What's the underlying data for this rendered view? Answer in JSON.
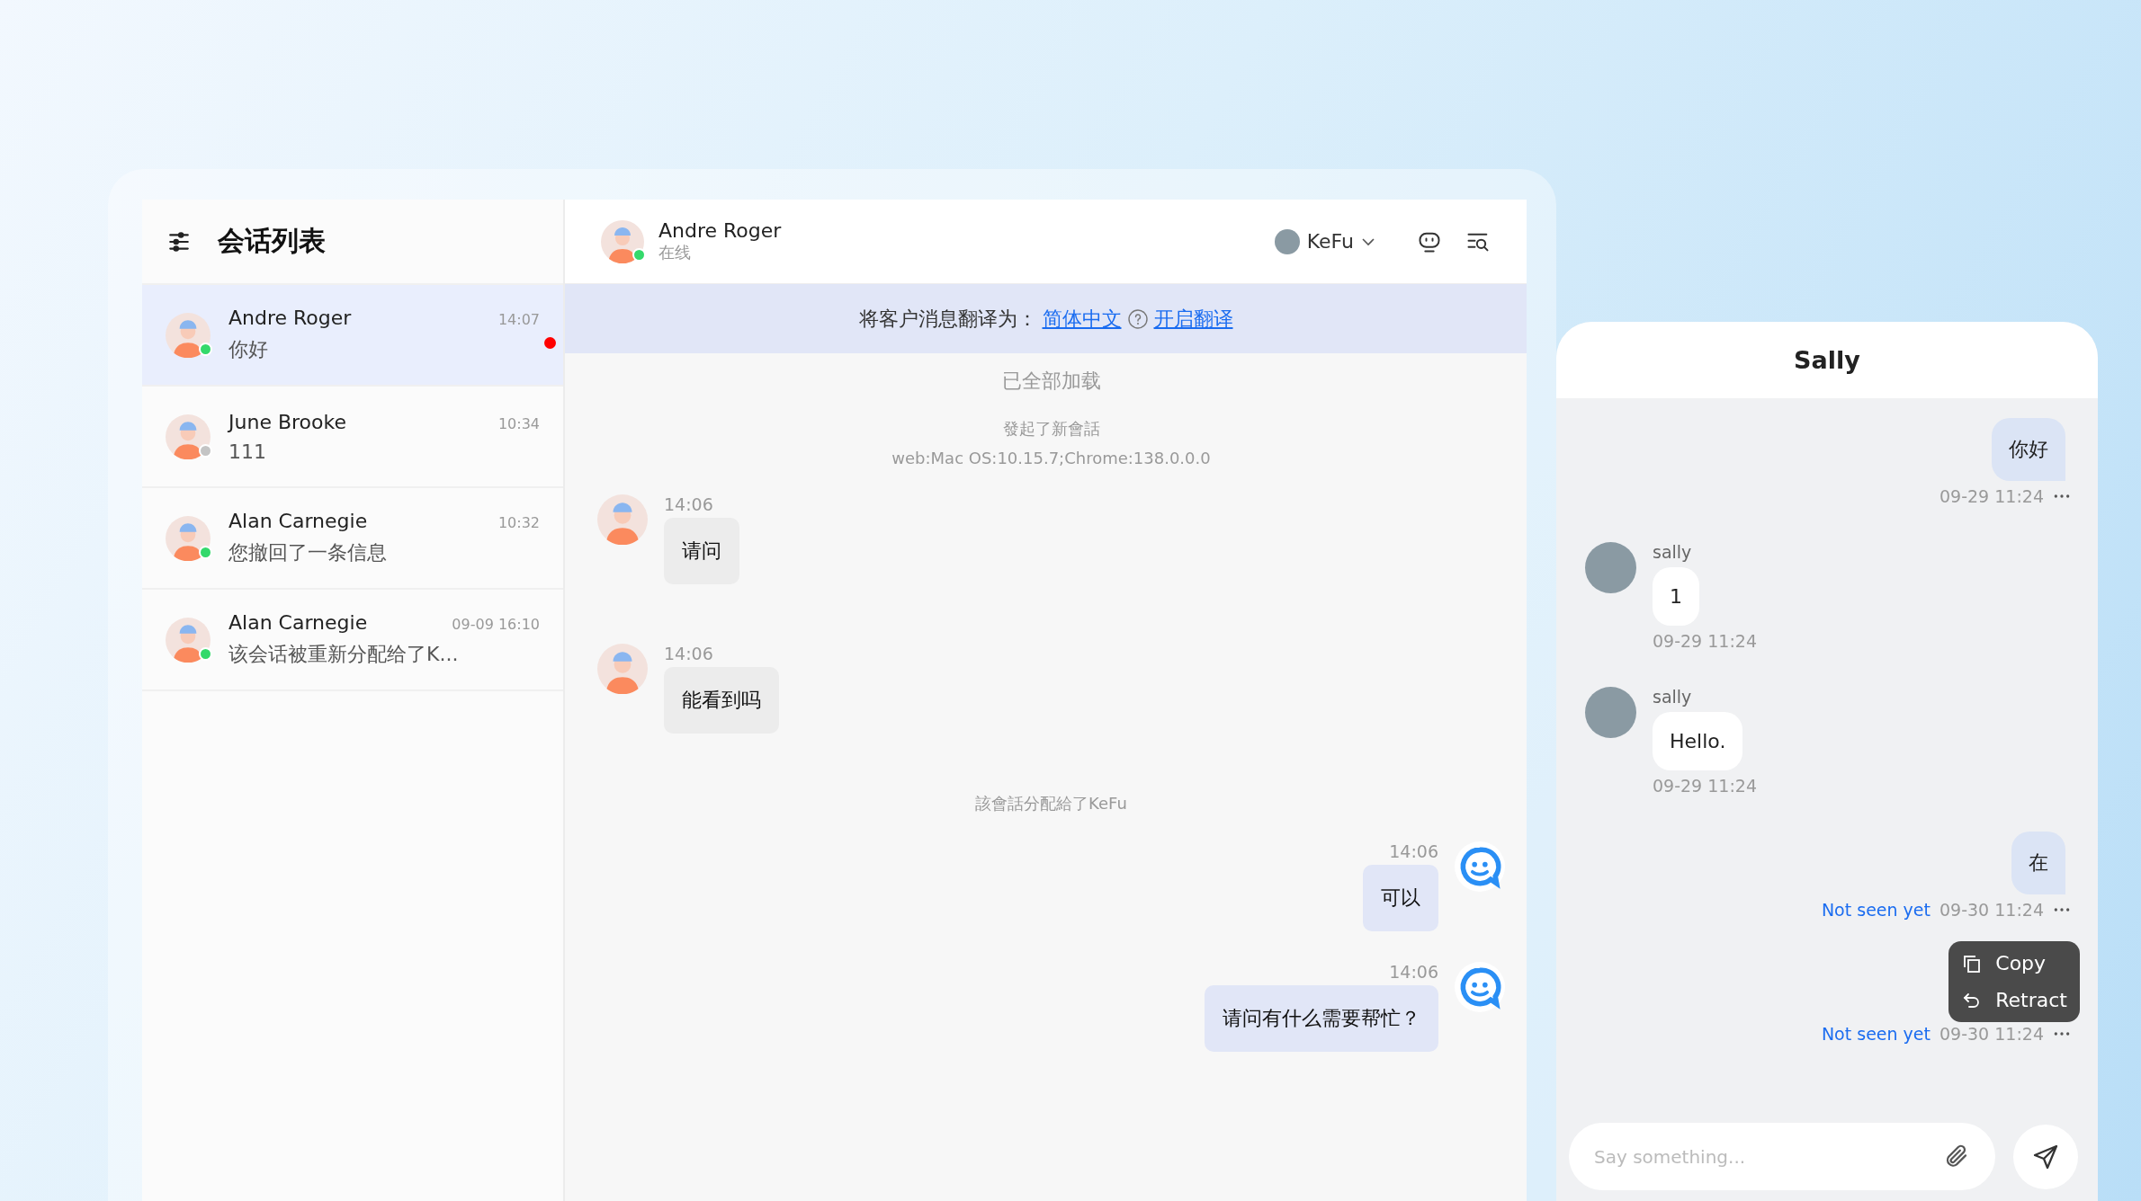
{
  "sidebar": {
    "title": "会话列表",
    "conversations": [
      {
        "name": "Andre Roger",
        "time": "14:07",
        "preview": "你好",
        "selected": true,
        "online": true,
        "unread": true
      },
      {
        "name": "June Brooke",
        "time": "10:34",
        "preview": "111",
        "selected": false,
        "online": false,
        "unread": false
      },
      {
        "name": "Alan Carnegie",
        "time": "10:32",
        "preview": "您撤回了一条信息",
        "selected": false,
        "online": true,
        "unread": false
      },
      {
        "name": "Alan Carnegie",
        "time": "09-09 16:10",
        "preview": "该会话被重新分配给了K...",
        "selected": false,
        "online": true,
        "unread": false
      }
    ]
  },
  "chat": {
    "contact": {
      "name": "Andre Roger",
      "status": "在线",
      "online": true
    },
    "agent": {
      "name": "KeFu"
    },
    "translate_bar": {
      "label": "将客户消息翻译为：",
      "language": "简体中文",
      "action": "开启翻译"
    },
    "messages": [
      {
        "kind": "divider",
        "text": "已全部加载"
      },
      {
        "kind": "system",
        "lines": [
          "發起了新會話",
          "web:Mac OS:10.15.7;Chrome:138.0.0.0"
        ]
      },
      {
        "kind": "incoming",
        "time": "14:06",
        "text": "请问"
      },
      {
        "kind": "incoming",
        "time": "14:06",
        "text": "能看到吗"
      },
      {
        "kind": "system",
        "lines": [
          "該會話分配給了KeFu"
        ]
      },
      {
        "kind": "outgoing",
        "time": "14:06",
        "text": "可以"
      },
      {
        "kind": "outgoing",
        "time": "14:06",
        "text": "请问有什么需要帮忙？"
      }
    ]
  },
  "widget": {
    "title": "Sally",
    "messages": [
      {
        "kind": "outgoing",
        "text": "你好",
        "time": "09-29 11:24"
      },
      {
        "kind": "incoming",
        "sender": "sally",
        "text": "1",
        "time": "09-29 11:24"
      },
      {
        "kind": "incoming",
        "sender": "sally",
        "text": "Hello.",
        "time": "09-29 11:24"
      },
      {
        "kind": "outgoing",
        "text": "在",
        "status": "Not seen yet",
        "time": "09-30 11:24"
      },
      {
        "kind": "outgoing",
        "status": "Not seen yet",
        "time": "09-30 11:24",
        "menu_open": true
      }
    ],
    "menu": {
      "items": [
        {
          "kind": "copy",
          "label": "Copy"
        },
        {
          "kind": "retract",
          "label": "Retract"
        }
      ]
    },
    "input": {
      "placeholder": "Say something..."
    }
  }
}
